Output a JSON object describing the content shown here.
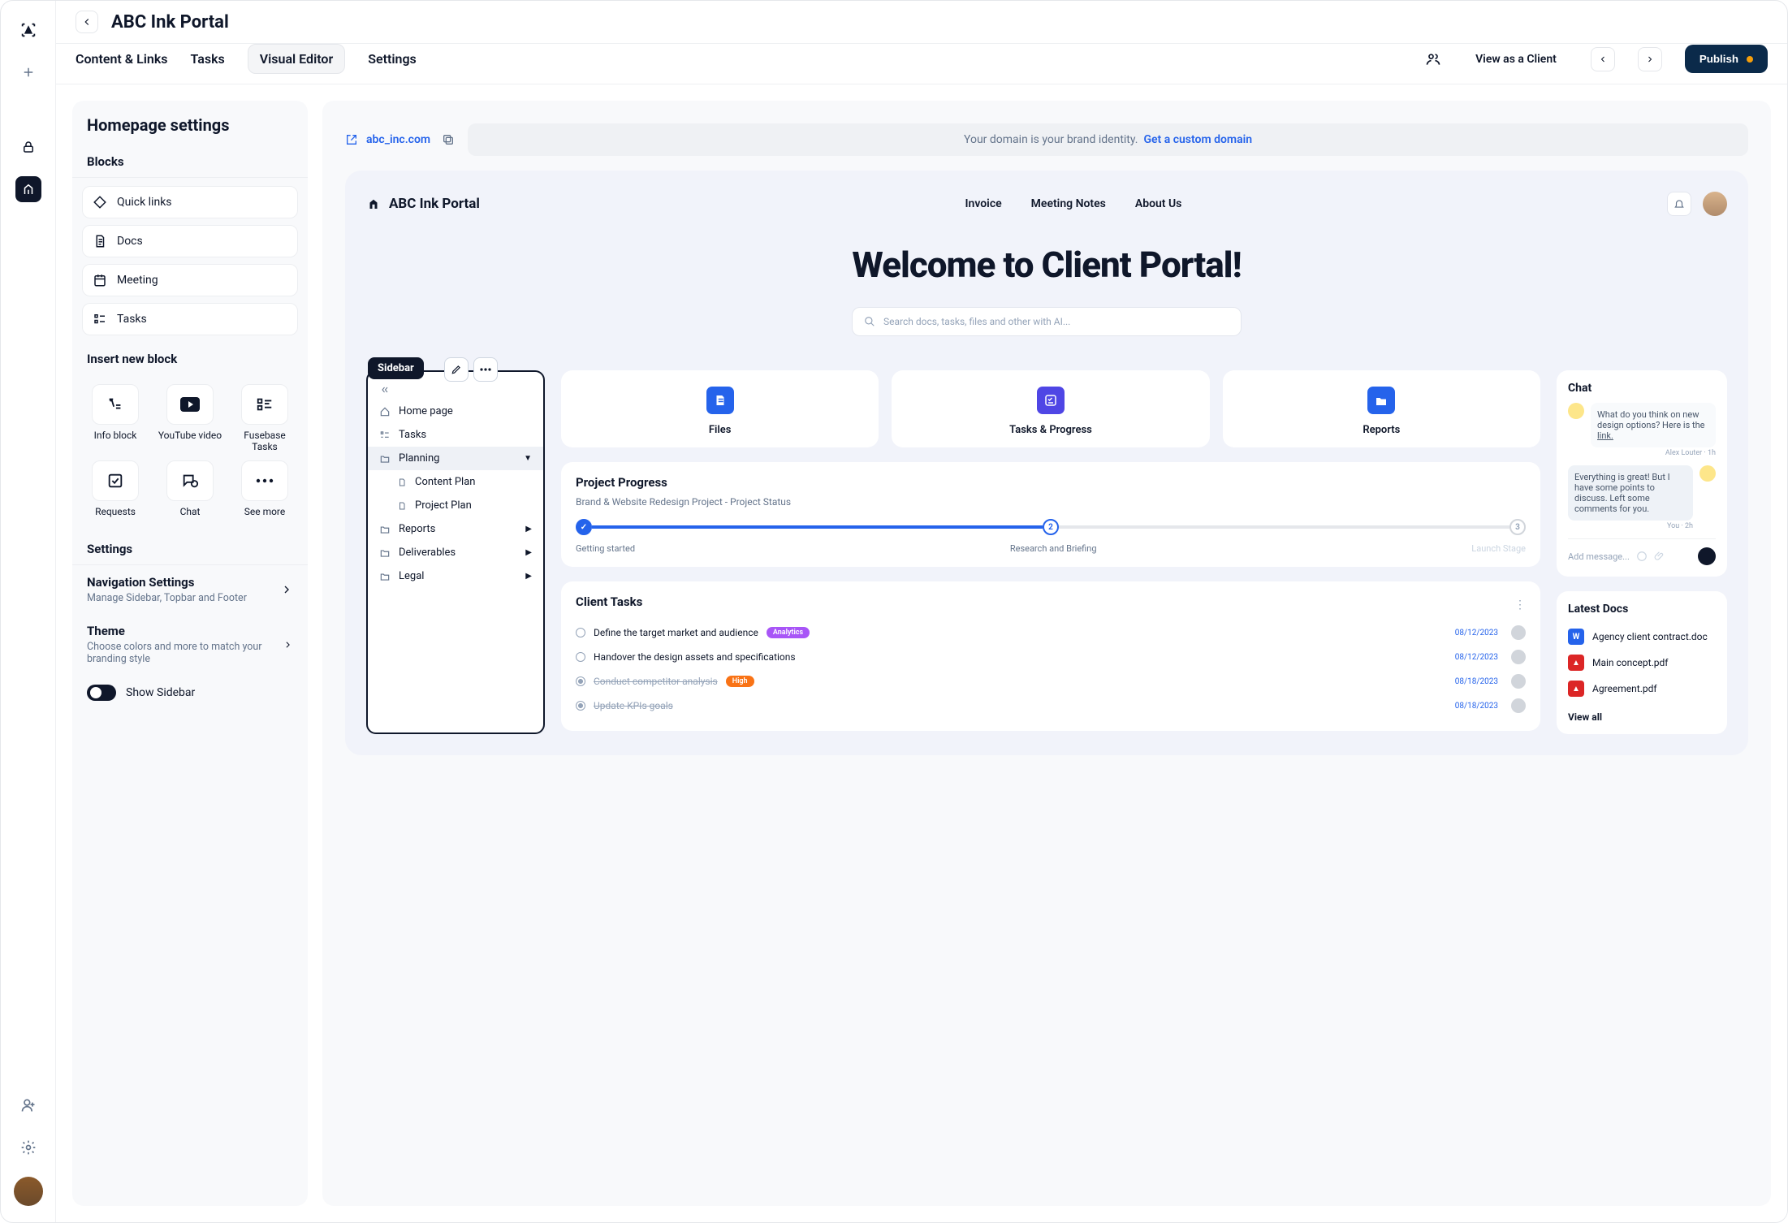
{
  "header": {
    "title": "ABC Ink Portal",
    "tabs": [
      "Content & Links",
      "Tasks",
      "Visual Editor",
      "Settings"
    ],
    "activeTab": 2,
    "viewAs": "View as a Client",
    "publish": "Publish"
  },
  "settingsPanel": {
    "title": "Homepage settings",
    "blocksHeader": "Blocks",
    "blocks": [
      "Quick links",
      "Docs",
      "Meeting",
      "Tasks"
    ],
    "insertHeader": "Insert new block",
    "insertItems": [
      "Info block",
      "YouTube video",
      "Fusebase Tasks",
      "Requests",
      "Chat",
      "See more"
    ],
    "settingsHeader": "Settings",
    "nav": {
      "title": "Navigation Settings",
      "sub": "Manage Sidebar, Topbar and Footer"
    },
    "theme": {
      "title": "Theme",
      "sub": "Choose colors and more to match your branding style"
    },
    "showSidebar": "Show Sidebar"
  },
  "canvas": {
    "domain": "abc_inc.com",
    "bannerText": "Your domain is your brand identity.",
    "bannerLink": "Get a custom domain"
  },
  "portal": {
    "brand": "ABC Ink Portal",
    "nav": [
      "Invoice",
      "Meeting Notes",
      "About Us"
    ],
    "hero": "Welcome to Client Portal!",
    "searchPlaceholder": "Search docs, tasks, files and other with AI..."
  },
  "sidebar": {
    "label": "Sidebar",
    "items": [
      {
        "label": "Home page"
      },
      {
        "label": "Tasks"
      },
      {
        "label": "Planning",
        "expanded": true,
        "children": [
          "Content Plan",
          "Project Plan"
        ]
      },
      {
        "label": "Reports",
        "hasChildren": true
      },
      {
        "label": "Deliverables",
        "hasChildren": true
      },
      {
        "label": "Legal",
        "hasChildren": true
      }
    ]
  },
  "tiles": [
    "Files",
    "Tasks & Progress",
    "Reports"
  ],
  "progress": {
    "title": "Project Progress",
    "subtitle": "Brand & Website Redesign Project - Project Status",
    "stages": [
      "Getting started",
      "Research and Briefing",
      "Launch Stage"
    ]
  },
  "clientTasks": {
    "title": "Client Tasks",
    "items": [
      {
        "text": "Define the target market and audience",
        "badge": "Analytics",
        "badgeColor": "purple",
        "date": "08/12/2023",
        "done": false
      },
      {
        "text": "Handover the design assets and specifications",
        "date": "08/12/2023",
        "done": false
      },
      {
        "text": "Conduct competitor analysis",
        "badge": "High",
        "badgeColor": "orange",
        "date": "08/18/2023",
        "done": true
      },
      {
        "text": "Update KPIs goals",
        "date": "08/18/2023",
        "done": true
      }
    ]
  },
  "chat": {
    "title": "Chat",
    "msg1": "What do you think on new design options? Here is the ",
    "msg1link": "link.",
    "meta1": "Alex Louter · 1h",
    "msg2": "Everything is great! But I have some points to discuss. Left some comments for you.",
    "meta2": "You · 2h",
    "input": "Add message..."
  },
  "docs": {
    "title": "Latest Docs",
    "items": [
      {
        "name": "Agency client contract.doc",
        "type": "word"
      },
      {
        "name": "Main concept.pdf",
        "type": "pdf"
      },
      {
        "name": "Agreement.pdf",
        "type": "pdf"
      }
    ],
    "viewAll": "View all"
  }
}
